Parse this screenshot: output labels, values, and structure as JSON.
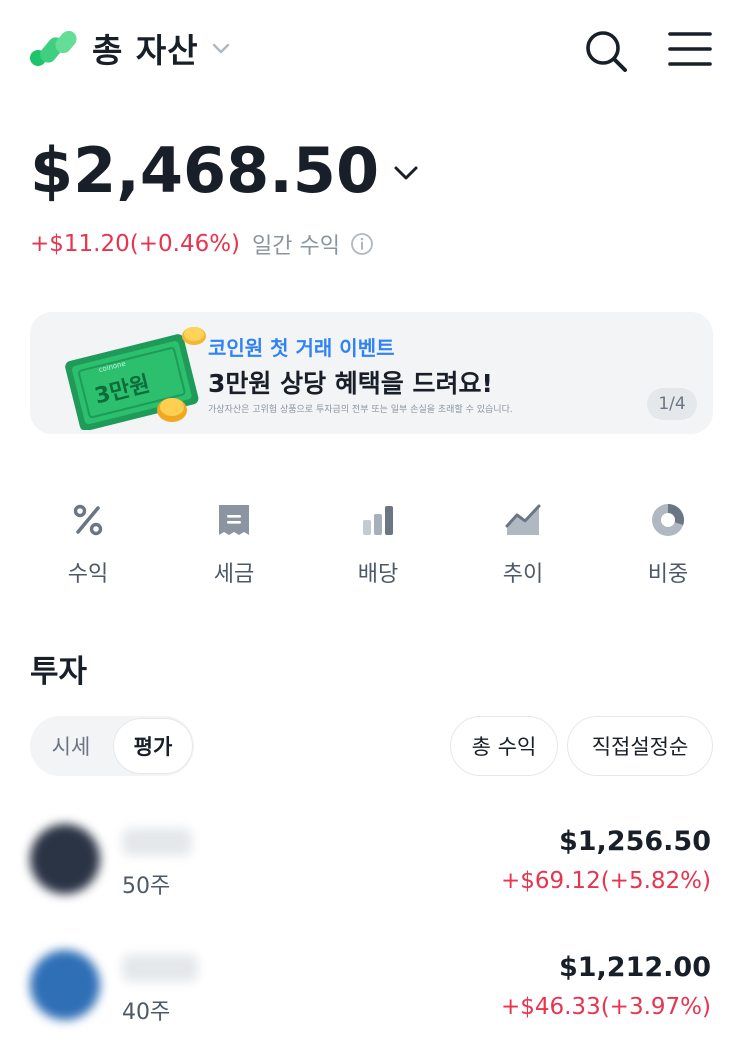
{
  "header": {
    "title": "총 자산",
    "icons": [
      "logo-icon",
      "chevron-down-icon",
      "search-icon",
      "menu-icon"
    ],
    "brand_color": "#25c16f"
  },
  "summary": {
    "balance": "$2,468.50",
    "change": "+$11.20(+0.46%)",
    "change_label": "일간 수익",
    "gain_color": "#e8344e"
  },
  "banner": {
    "sub": "코인원 첫 거래 이벤트",
    "title": "3만원 상당 혜택을 드려요!",
    "note": "가상자산은 고위험 상품으로 투자금의 전부 또는 일부 손실을 초래할 수 있습니다.",
    "page": "1/4",
    "ticket_text": "3만원",
    "ticket_brand": "coinone"
  },
  "quick_menu": [
    {
      "label": "수익",
      "icon": "percent-icon"
    },
    {
      "label": "세금",
      "icon": "receipt-icon"
    },
    {
      "label": "배당",
      "icon": "bar-chart-icon"
    },
    {
      "label": "추이",
      "icon": "trend-chart-icon"
    },
    {
      "label": "비중",
      "icon": "pie-chart-icon"
    }
  ],
  "investments": {
    "title": "투자",
    "segment": [
      "시세",
      "평가"
    ],
    "segment_selected": "평가",
    "sort_total": "총 수익",
    "sort_custom": "직접설정순",
    "holdings": [
      {
        "shares": "50주",
        "amount": "$1,256.50",
        "gain": "+$69.12(+5.82%)",
        "avatar_color": "#2b3445"
      },
      {
        "shares": "40주",
        "amount": "$1,212.00",
        "gain": "+$46.33(+3.97%)",
        "avatar_color": "#2f6fb6"
      }
    ]
  }
}
